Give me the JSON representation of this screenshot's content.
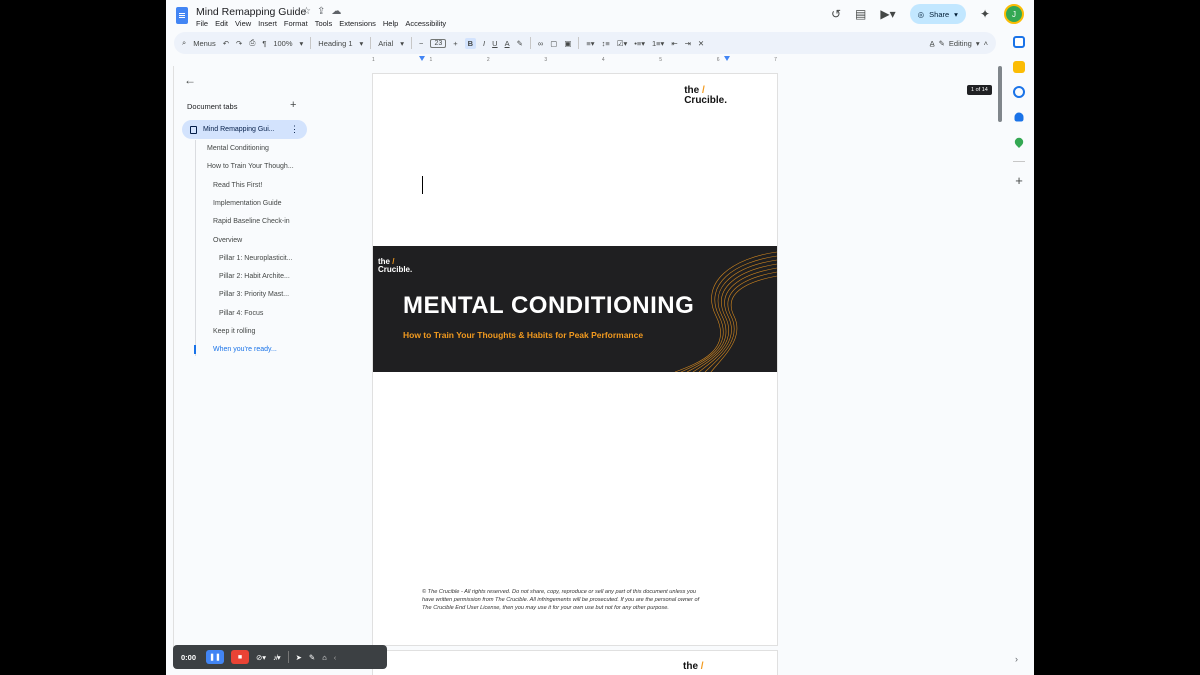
{
  "document": {
    "title": "Mind Remapping Guide",
    "menu": [
      "File",
      "Edit",
      "View",
      "Insert",
      "Format",
      "Tools",
      "Extensions",
      "Help",
      "Accessibility"
    ]
  },
  "header": {
    "share_label": "Share",
    "avatar_initial": "J"
  },
  "toolbar": {
    "menus_label": "Menus",
    "zoom": "100%",
    "style": "Heading 1",
    "font": "Arial",
    "font_size": "23",
    "mode": "Editing"
  },
  "ruler": {
    "ticks": [
      "1",
      "1",
      "2",
      "3",
      "4",
      "5",
      "6",
      "7"
    ]
  },
  "sidebar": {
    "tabs_header": "Document tabs",
    "active_tab": "Mind Remapping Gui...",
    "outline": [
      {
        "label": "Mental Conditioning",
        "level": 1
      },
      {
        "label": "How to Train Your Though...",
        "level": 1
      },
      {
        "label": "Read This First!",
        "level": 2
      },
      {
        "label": "Implementation Guide",
        "level": 2
      },
      {
        "label": "Rapid Baseline Check-in",
        "level": 2
      },
      {
        "label": "Overview",
        "level": 2
      },
      {
        "label": "Pillar 1: Neuroplasticit...",
        "level": 3
      },
      {
        "label": "Pillar 2: Habit Archite...",
        "level": 3
      },
      {
        "label": "Pillar 3: Priority Mast...",
        "level": 3
      },
      {
        "label": "Pillar 4: Focus",
        "level": 3
      },
      {
        "label": "Keep it rolling",
        "level": 2
      },
      {
        "label": "When you're ready...",
        "level": 2,
        "active": true
      }
    ]
  },
  "page": {
    "logo_the": "the",
    "logo_name": "Crucible.",
    "banner_title": "MENTAL CONDITIONING",
    "banner_subtitle": "How to Train Your Thoughts & Habits for Peak Performance",
    "footer_line1": "© The Crucible - All rights reserved.  Do not share, copy, reproduce or sell any part of this document unless you",
    "footer_line2": "have written permission from The Crucible.  All infringements will be prosecuted.  If you are the personal owner of",
    "footer_line3": "The Crucible End User License, then you may use it for your own use but not for any other purpose.",
    "page_indicator": "1 of 14"
  },
  "recorder": {
    "time": "0:00"
  },
  "colors": {
    "accent": "#1a73e8",
    "brand_orange": "#f29a1f",
    "banner_bg": "#1f1f21",
    "share_bg": "#c2e7ff"
  }
}
